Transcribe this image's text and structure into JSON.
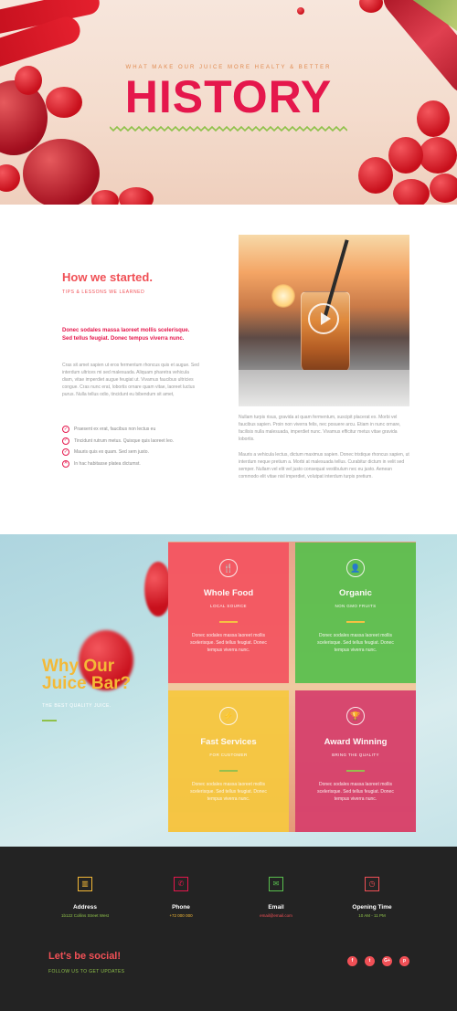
{
  "hero": {
    "subtitle": "WHAT MAKE OUR JUICE MORE HEALTY & BETTER",
    "title": "HISTORY"
  },
  "story": {
    "title": "How we started.",
    "tagline": "TIPS & LESSONS WE LEARNED",
    "lead": "Donec sodales massa laoreet mollis scelerisque. Sed tellus feugiat. Donec tempus viverra nunc.",
    "body": "Cras sit amet sapien ut eros fermentum rhoncus quis et augue. Sed interdum ultrices mi sed malesuada. Aliquam pharetra vehicula diam, vitae imperdiet augue feugiat ut. Vivamus faucibus ultricies congue. Cras nunc erat, lobortis ornare quam vitae, laoreet luctus purus. Nulla tellus odio, tincidunt eu bibendum sit amet,",
    "list": [
      {
        "text": "Praesent ex erat, faucibus non lectus eu",
        "mark": "✓"
      },
      {
        "text": "Tincidunt rutrum metus. Quisque quis laoreet leo.",
        "mark": "✓"
      },
      {
        "text": "Mauris quis ex quam. Sed sem justo.",
        "mark": "✓"
      },
      {
        "text": "In hac habitasse platea dictumst.",
        "mark": "✕"
      }
    ],
    "right_p1": "Nullam turpis risus, gravida at quam fermentum, suscipit placerat ex. Morbi vel faucibus sapien. Proin non viverra felis, nec posuere arcu. Etiam in nunc ornare, facilisis nulla malesuada, imperdiet nunc. Vivamus efficitur metus vitae gravida lobortis.",
    "right_p2": "Mauris a vehicula lectus, dictum maximus sapien. Donec tristique rhoncus sapien, ut interdum neque pretium a. Morbi at malesuada tellus. Curabitur dictum in velit sed semper. Nullam vel elit vel justo consequat vestibulum nec eu justo. Aenean commodo elit vitae nisl imperdiet, volutpat interdum turpis pretium."
  },
  "why": {
    "title": "Why Our Juice Bar?",
    "subtitle": "THE BEST QUALITY JUICE.",
    "cards": [
      {
        "title": "Whole Food",
        "sub": "LOCAL SOURCE",
        "desc": "Donec sodales massa laoreet mollis scelerisque. Sed tellus feugiat. Donec tempus viverra nunc.",
        "icon": "fork-knife-icon",
        "glyph": "🍴",
        "color": "#f45460",
        "bar": "#f7c23c"
      },
      {
        "title": "Organic",
        "sub": "NON GMO FRUITS",
        "desc": "Donec sodales massa laoreet mollis scelerisque. Sed tellus feugiat. Donec tempus viverra nunc.",
        "icon": "user-icon",
        "glyph": "👤",
        "color": "#59c04e",
        "bar": "#f7c23c"
      },
      {
        "title": "Fast Services",
        "sub": "FOR CUSTOMER",
        "desc": "Donec sodales massa laoreet mollis scelerisque. Sed tellus feugiat. Donec tempus viverra nunc.",
        "icon": "lightning-icon",
        "glyph": "⚡",
        "color": "#f6c83f",
        "bar": "#8fc14a"
      },
      {
        "title": "Award Winning",
        "sub": "BRING THE QUALITY",
        "desc": "Donec sodales massa laoreet mollis scelerisque. Sed tellus feugiat. Donec tempus viverra nunc.",
        "icon": "trophy-icon",
        "glyph": "🏆",
        "color": "#d63f6c",
        "bar": "#8fc14a"
      }
    ]
  },
  "footer": {
    "info": [
      {
        "title": "Address",
        "value": "1b122 Collins Street West",
        "icon": "building-icon",
        "glyph": "▥",
        "color": "#f4b937",
        "valcolor": "#8fc14a"
      },
      {
        "title": "Phone",
        "value": "+72 000 000",
        "icon": "phone-icon",
        "glyph": "✆",
        "color": "#e5174c",
        "valcolor": "#f4b937"
      },
      {
        "title": "Email",
        "value": "email@email.com",
        "icon": "mail-icon",
        "glyph": "✉",
        "color": "#59c04e",
        "valcolor": "#f05056"
      },
      {
        "title": "Opening Time",
        "value": "10 AM - 11 PM",
        "icon": "clock-icon",
        "glyph": "◷",
        "color": "#f05056",
        "valcolor": "#8fc14a"
      }
    ],
    "social_title": "Let's be social!",
    "social_sub": "FOLLOW US TO GET UPDATES",
    "social": [
      {
        "name": "facebook-icon",
        "glyph": "f"
      },
      {
        "name": "twitter-icon",
        "glyph": "t"
      },
      {
        "name": "google-plus-icon",
        "glyph": "G+"
      },
      {
        "name": "pinterest-icon",
        "glyph": "p"
      }
    ]
  },
  "colors": {
    "accent": "#e5174c",
    "coral": "#f05056",
    "green": "#8fc14a",
    "yellow": "#f4b937",
    "dark": "#232323"
  }
}
